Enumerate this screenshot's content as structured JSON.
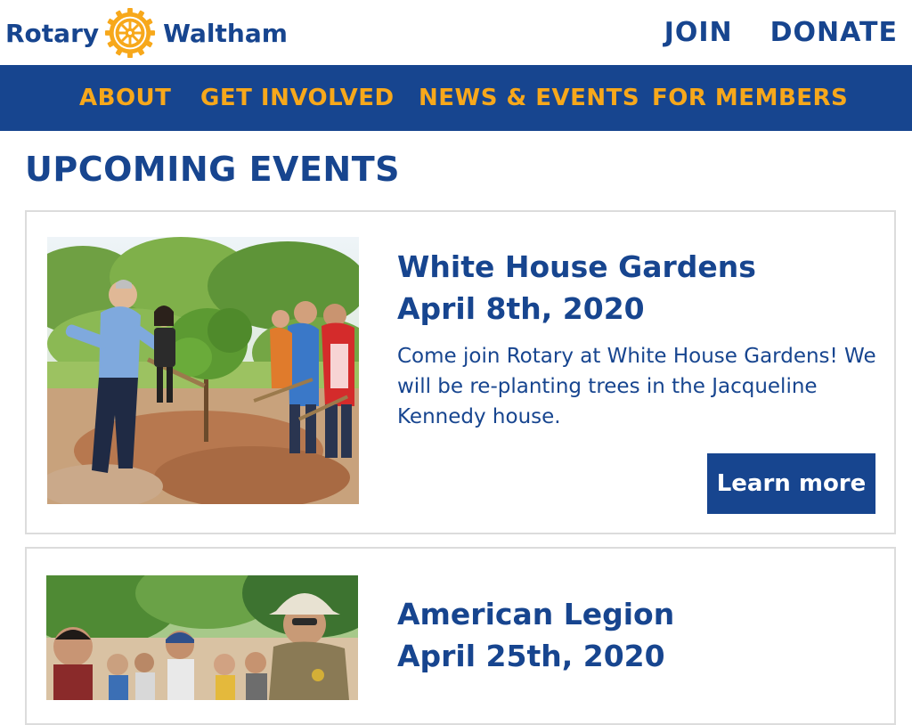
{
  "header": {
    "logo_word": "Rotary",
    "club_name": "Waltham",
    "links": {
      "join": "JOIN",
      "donate": "DONATE"
    }
  },
  "nav": {
    "items": [
      {
        "label": "ABOUT"
      },
      {
        "label": "GET INVOLVED"
      },
      {
        "label": "NEWS & EVENTS"
      },
      {
        "label": "FOR MEMBERS"
      }
    ]
  },
  "main": {
    "section_title": "UPCOMING EVENTS",
    "events": [
      {
        "title": "White House Gardens",
        "date": "April 8th, 2020",
        "description": "Come join Rotary at White House Gardens! We will be re-planting trees in the Jacqueline Kennedy house.",
        "button_label": "Learn more"
      },
      {
        "title": "American Legion",
        "date": "April 25th, 2020"
      }
    ]
  },
  "colors": {
    "brand_blue": "#17458f",
    "brand_gold": "#f7a81b",
    "card_border": "#dcdcdc"
  },
  "icons": {
    "logo_wheel": "rotary-wheel-icon"
  }
}
